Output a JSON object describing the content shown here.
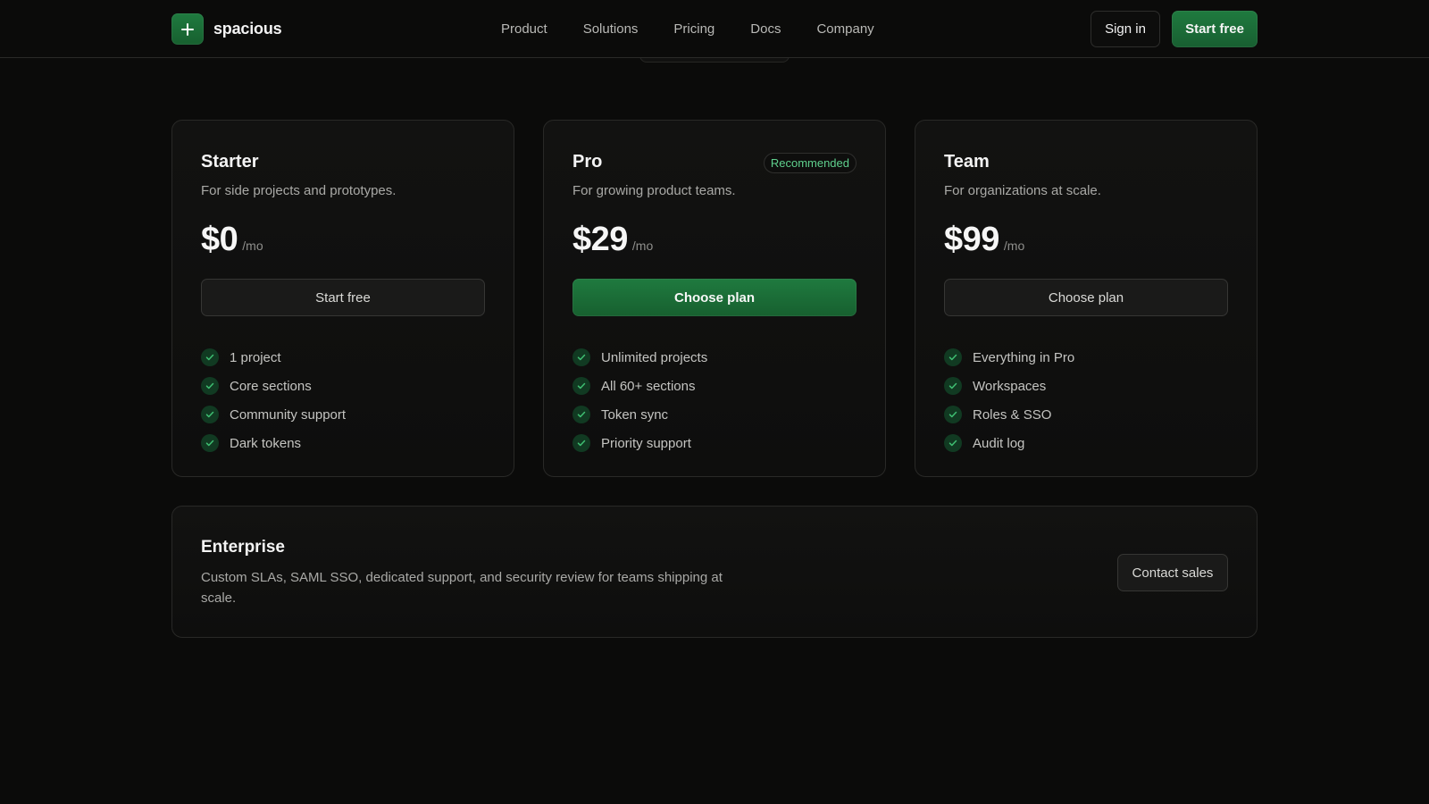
{
  "brand": {
    "name": "spacious",
    "logo_icon": "plus-icon",
    "accent": "#1f7a3f"
  },
  "nav": {
    "links": [
      "Product",
      "Solutions",
      "Pricing",
      "Docs",
      "Company"
    ],
    "sign_in": "Sign in",
    "start_free": "Start free"
  },
  "plans": [
    {
      "name": "Starter",
      "description": "For side projects and prototypes.",
      "price": "$0",
      "period": "/mo",
      "cta": "Start free",
      "badge": "",
      "features": [
        "1 project",
        "Core sections",
        "Community support",
        "Dark tokens"
      ]
    },
    {
      "name": "Pro",
      "description": "For growing product teams.",
      "price": "$29",
      "period": "/mo",
      "cta": "Choose plan",
      "badge": "Recommended",
      "features": [
        "Unlimited projects",
        "All 60+ sections",
        "Token sync",
        "Priority support"
      ]
    },
    {
      "name": "Team",
      "description": "For organizations at scale.",
      "price": "$99",
      "period": "/mo",
      "cta": "Choose plan",
      "badge": "",
      "features": [
        "Everything in Pro",
        "Workspaces",
        "Roles & SSO",
        "Audit log"
      ]
    }
  ],
  "enterprise": {
    "title": "Enterprise",
    "description": "Custom SLAs, SAML SSO, dedicated support, and security review for teams shipping at scale.",
    "cta": "Contact sales"
  },
  "colors": {
    "background": "#0b0b0a",
    "check": "#3fbf72",
    "badge_text": "#5fd08d"
  }
}
